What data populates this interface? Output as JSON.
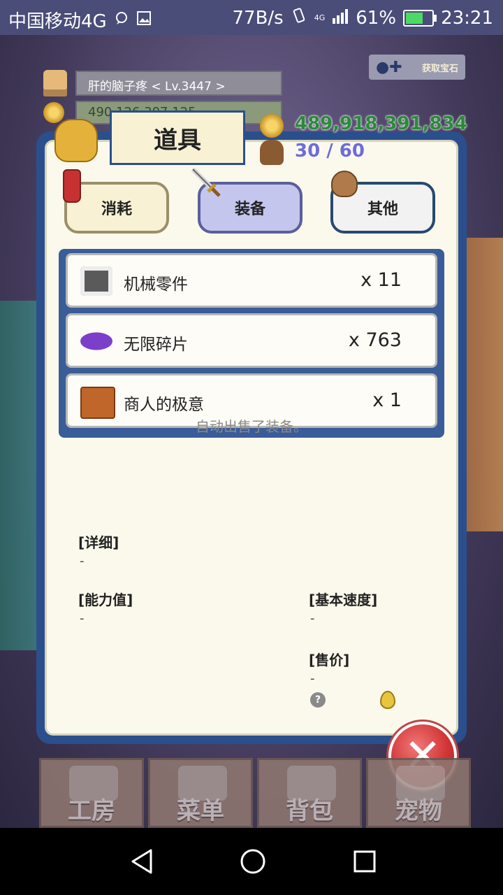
{
  "status_bar": {
    "carrier": "中国移动4G",
    "speed": "77B/s",
    "network": "4G",
    "battery": "61%",
    "battery_level": 0.61,
    "time": "23:21"
  },
  "player": {
    "name_level": "肝的脑子疼  < Lv.3447 >",
    "gold_partial": "490,126,307,125",
    "plus_badge_text": "获取宝石"
  },
  "panel": {
    "title": "道具",
    "gold": "489,918,391,834",
    "capacity": "30 / 60"
  },
  "tabs": [
    {
      "label": "消耗"
    },
    {
      "label": "装备"
    },
    {
      "label": "其他"
    }
  ],
  "items": [
    {
      "name": "机械零件",
      "qty": "x 11",
      "icon": "gear-parts-icon"
    },
    {
      "name": "无限碎片",
      "qty": "x 763",
      "icon": "crystal-shard-icon"
    },
    {
      "name": "商人的极意",
      "qty": "x 1",
      "icon": "chest-icon"
    }
  ],
  "toast": "自动出售了装备。",
  "detail": {
    "detail_label": "[详细]",
    "detail_value": "-",
    "ability_label": "[能力值]",
    "ability_value": "-",
    "speed_label": "[基本速度]",
    "speed_value": "-",
    "price_label": "[售价]",
    "price_value": "-",
    "help_icon_text": "?"
  },
  "bottom_menu": [
    {
      "label": "工房"
    },
    {
      "label": "菜单"
    },
    {
      "label": "背包"
    },
    {
      "label": "宠物"
    }
  ],
  "close_glyph": "✕"
}
